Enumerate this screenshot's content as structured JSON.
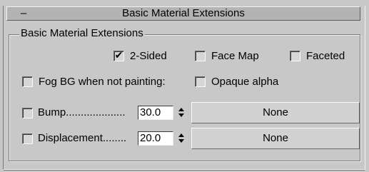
{
  "rollout": {
    "toggle_symbol": "–",
    "title": "Basic Material Extensions"
  },
  "group": {
    "title": "Basic Material Extensions"
  },
  "checkboxes": {
    "two_sided": {
      "label": "2-Sided",
      "checked": true
    },
    "face_map": {
      "label": "Face Map",
      "checked": false
    },
    "faceted": {
      "label": "Faceted",
      "checked": false
    },
    "fog_bg": {
      "label": "Fog BG when not painting:",
      "checked": false
    },
    "opaque_alpha": {
      "label": "Opaque alpha",
      "checked": false
    }
  },
  "bump": {
    "checked": false,
    "label": "Bump....................",
    "value": "30.0",
    "map_button": "None"
  },
  "displacement": {
    "checked": false,
    "label": "Displacement........",
    "value": "20.0",
    "map_button": "None"
  },
  "tick_glyph": "✔"
}
